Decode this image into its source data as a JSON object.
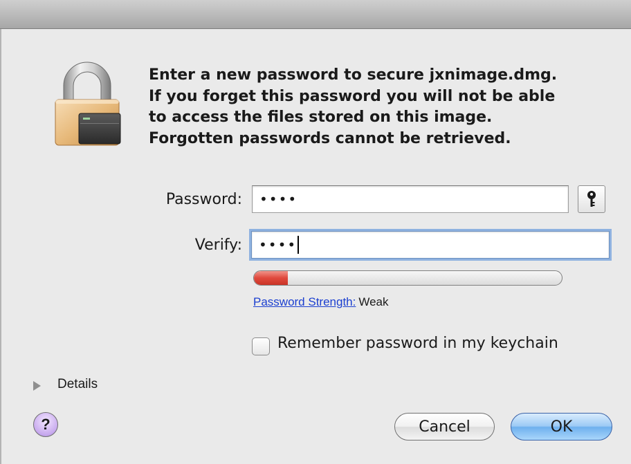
{
  "dialog": {
    "message_lines": [
      "Enter a new password to secure jxnimage.dmg.",
      "If you forget this password you will not be able",
      "to access the files stored on this image.",
      "Forgotten passwords cannot be retrieved."
    ]
  },
  "form": {
    "password_label": "Password:",
    "password_value": "••••",
    "verify_label": "Verify:",
    "verify_value": "••••",
    "strength_link": "Password Strength:",
    "strength_value": "Weak",
    "strength_level": 0.11,
    "remember_label": "Remember password in my keychain",
    "remember_checked": false
  },
  "footer": {
    "details_label": "Details",
    "help_symbol": "?",
    "cancel_label": "Cancel",
    "ok_label": "OK"
  },
  "icons": {
    "lock": "padlock-disk-image-icon",
    "key": "key-icon",
    "disclosure": "disclosure-triangle-icon",
    "help": "help-icon"
  },
  "colors": {
    "strength_bar": "#e0493d",
    "link": "#1b3fd0",
    "default_button": "#6fb0ee",
    "focus_ring": "#8fb2e0"
  }
}
